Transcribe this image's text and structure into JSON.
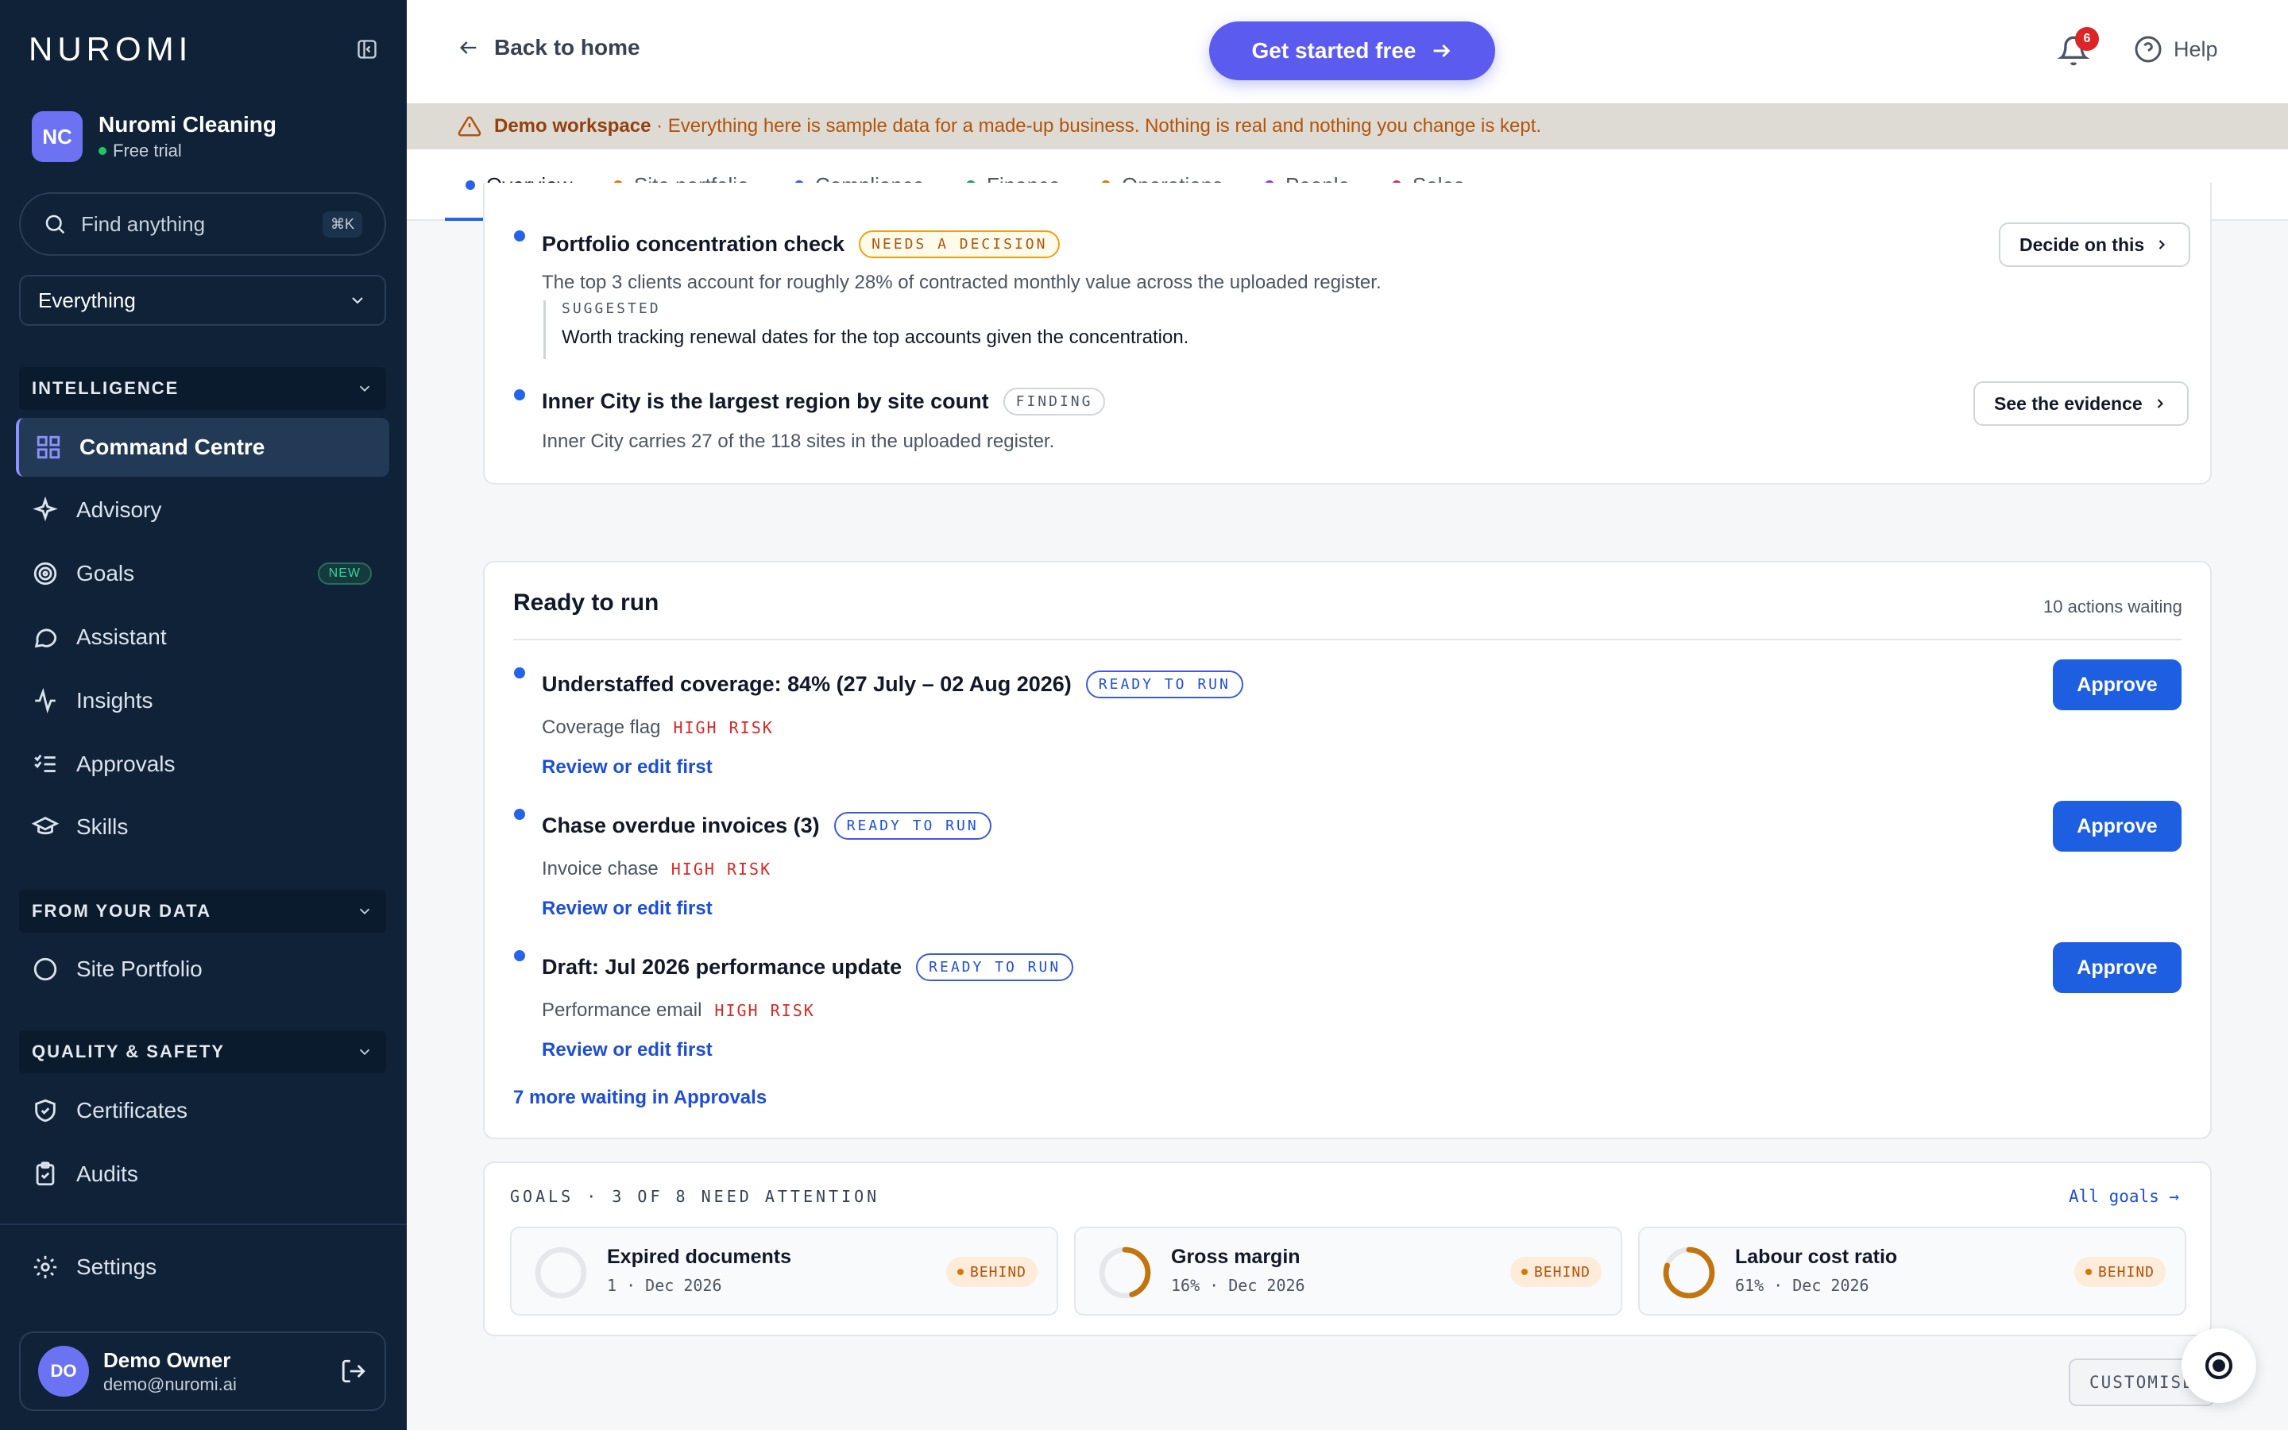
{
  "sidebar": {
    "logo": "NUROMI",
    "workspace": {
      "initials": "NC",
      "name": "Nuromi Cleaning",
      "plan": "Free trial"
    },
    "search": {
      "placeholder": "Find anything",
      "shortcut": "⌘K"
    },
    "scope": "Everything",
    "sections": {
      "intelligence": "INTELLIGENCE",
      "from_your_data": "FROM YOUR DATA",
      "quality_safety": "QUALITY & SAFETY"
    },
    "items": {
      "command_centre": "Command Centre",
      "advisory": "Advisory",
      "goals": "Goals",
      "goals_badge": "NEW",
      "assistant": "Assistant",
      "insights": "Insights",
      "approvals": "Approvals",
      "skills": "Skills",
      "site_portfolio": "Site Portfolio",
      "certificates": "Certificates",
      "audits": "Audits",
      "settings": "Settings"
    },
    "user": {
      "initials": "DO",
      "name": "Demo Owner",
      "email": "demo@nuromi.ai"
    }
  },
  "topbar": {
    "back": "Back to home",
    "cta": "Get started free",
    "notifications": "6",
    "help": "Help"
  },
  "banner": {
    "title": "Demo workspace",
    "text": "· Everything here is sample data for a made-up business. Nothing is real and nothing you change is kept."
  },
  "tabs": [
    {
      "label": "Overview",
      "color": "#2563eb"
    },
    {
      "label": "Site portfolio",
      "color": "#d97706"
    },
    {
      "label": "Compliance",
      "color": "#2563eb"
    },
    {
      "label": "Finance",
      "color": "#16a34a"
    },
    {
      "label": "Operations",
      "color": "#d97706"
    },
    {
      "label": "People",
      "color": "#9333ea"
    },
    {
      "label": "Sales",
      "color": "#db2777"
    }
  ],
  "findings": [
    {
      "title": "Portfolio concentration check",
      "tag": "NEEDS A DECISION",
      "desc": "The top 3 clients account for roughly 28% of contracted monthly value across the uploaded register.",
      "suggested_label": "SUGGESTED",
      "suggested_text": "Worth tracking renewal dates for the top accounts given the concentration.",
      "action": "Decide on this"
    },
    {
      "title": "Inner City is the largest region by site count",
      "tag": "FINDING",
      "desc": "Inner City carries 27 of the 118 sites in the uploaded register.",
      "action": "See the evidence"
    }
  ],
  "ready": {
    "title": "Ready to run",
    "count": "10 actions waiting",
    "items": [
      {
        "title": "Understaffed coverage: 84% (27 July – 02 Aug 2026)",
        "tag": "READY TO RUN",
        "type": "Coverage flag",
        "risk": "HIGH RISK",
        "link": "Review or edit first",
        "button": "Approve"
      },
      {
        "title": "Chase overdue invoices (3)",
        "tag": "READY TO RUN",
        "type": "Invoice chase",
        "risk": "HIGH RISK",
        "link": "Review or edit first",
        "button": "Approve"
      },
      {
        "title": "Draft: Jul 2026 performance update",
        "tag": "READY TO RUN",
        "type": "Performance email",
        "risk": "HIGH RISK",
        "link": "Review or edit first",
        "button": "Approve"
      }
    ],
    "more": "7 more waiting in Approvals"
  },
  "goals": {
    "header": "GOALS · 3 OF 8 NEED ATTENTION",
    "all": "All goals →",
    "items": [
      {
        "name": "Expired documents",
        "sub": "1 · Dec 2026",
        "status": "BEHIND",
        "progress": 0
      },
      {
        "name": "Gross margin",
        "sub": "16% · Dec 2026",
        "status": "BEHIND",
        "progress": 0.45
      },
      {
        "name": "Labour cost ratio",
        "sub": "61% · Dec 2026",
        "status": "BEHIND",
        "progress": 0.8
      }
    ]
  },
  "customise": "CUSTOMISE",
  "colors": {
    "accent": "#5b5bf0",
    "primary_blue": "#1d5fe0",
    "sidebar_bg": "#0f2238",
    "warning": "#b45309",
    "risk": "#dc2626"
  }
}
